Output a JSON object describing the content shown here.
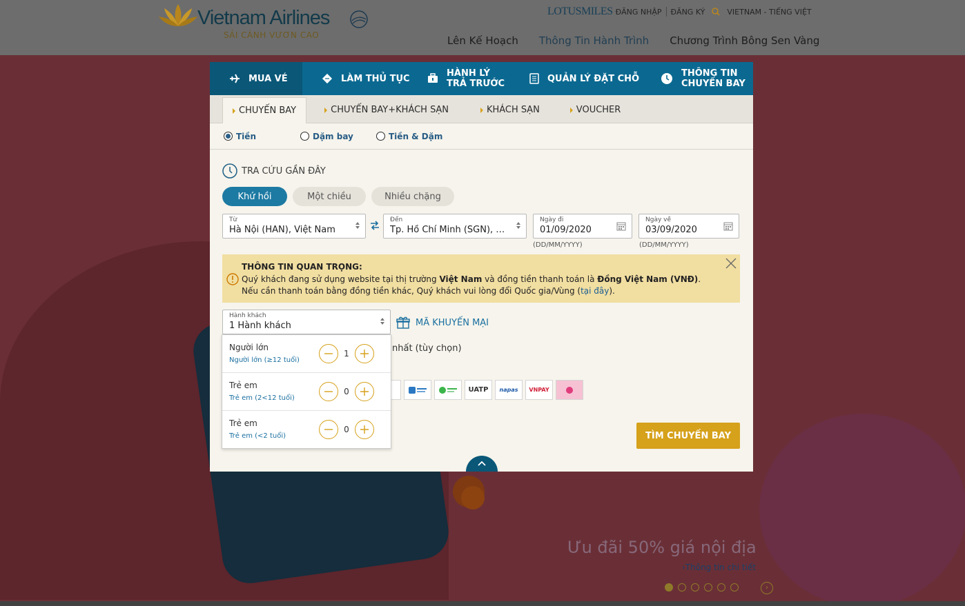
{
  "header": {
    "logo_name": "Vietnam Airlines",
    "logo_tag": "SẢI CÁNH VƯƠN CAO",
    "loyalty_brand": "LOTUSMILES",
    "login": "ĐĂNG NHẬP",
    "register": "ĐĂNG KÝ",
    "locale": "VIETNAM - TIẾNG VIỆT",
    "nav": [
      "Lên Kế Hoạch",
      "Thông Tin Hành Trình",
      "Chương Trình Bông Sen Vàng"
    ]
  },
  "tabs": [
    "MUA VÉ",
    "LÀM THỦ TỤC",
    "HÀNH LÝ\nTRẢ TRƯỚC",
    "QUẢN LÝ ĐẶT CHỖ",
    "THÔNG TIN\nCHUYẾN BAY"
  ],
  "subtabs": [
    "CHUYẾN BAY",
    "CHUYẾN BAY+KHÁCH SẠN",
    "KHÁCH SẠN",
    "VOUCHER"
  ],
  "paytypes": [
    "Tiền",
    "Dặm bay",
    "Tiền & Dặm"
  ],
  "recent": "TRA CỨU GẦN ĐÂY",
  "trip_types": [
    "Khứ hồi",
    "Một chiều",
    "Nhiều chặng"
  ],
  "from": {
    "label": "Từ",
    "value": "Hà Nội (HAN), Việt Nam"
  },
  "to": {
    "label": "Đến",
    "value": "Tp. Hồ Chí Minh (SGN), Việt Nam"
  },
  "depart": {
    "label": "Ngày đi",
    "value": "01/09/2020",
    "hint": "(DD/MM/YYYY)"
  },
  "return": {
    "label": "Ngày về",
    "value": "03/09/2020",
    "hint": "(DD/MM/YYYY)"
  },
  "notice": {
    "title": "THÔNG TIN QUAN TRỌNG:",
    "l1_a": "Quý khách đang sử dụng website tại thị trường ",
    "l1_b": "Việt Nam",
    "l1_c": " và đồng tiền thanh toán là ",
    "l1_d": "Đồng Việt Nam (VNĐ)",
    "l1_e": ".",
    "l2_a": "Nếu cần thanh toán bằng đồng tiền khác, Quý khách vui lòng đổi Quốc gia/Vùng (",
    "l2_link": "tại đây",
    "l2_b": ")."
  },
  "passengers": {
    "label": "Hành khách",
    "value": "1 Hành khách",
    "rows": [
      {
        "title": "Người lớn",
        "sub": "Người lớn (≥12 tuổi)",
        "count": "1"
      },
      {
        "title": "Trẻ em",
        "sub": "Trẻ em (2<12 tuổi)",
        "count": "0"
      },
      {
        "title": "Trẻ em",
        "sub": "Trẻ em (<2 tuổi)",
        "count": "0"
      }
    ]
  },
  "promo_code": "MÃ KHUYẾN MẠI",
  "optional_text": "nhất (tùy chọn)",
  "payment_icons": [
    "",
    "",
    "",
    "UATP",
    "napas",
    "VNPAY",
    ""
  ],
  "search_button": "TÌM CHUYẾN BAY",
  "hero": {
    "promo": "Ưu đãi 50% giá nội địa",
    "link": "›Thông tin chi tiết"
  },
  "colors": {
    "primary": "#0b6991",
    "accent": "#d6a11b",
    "notice": "#f1dea1"
  }
}
